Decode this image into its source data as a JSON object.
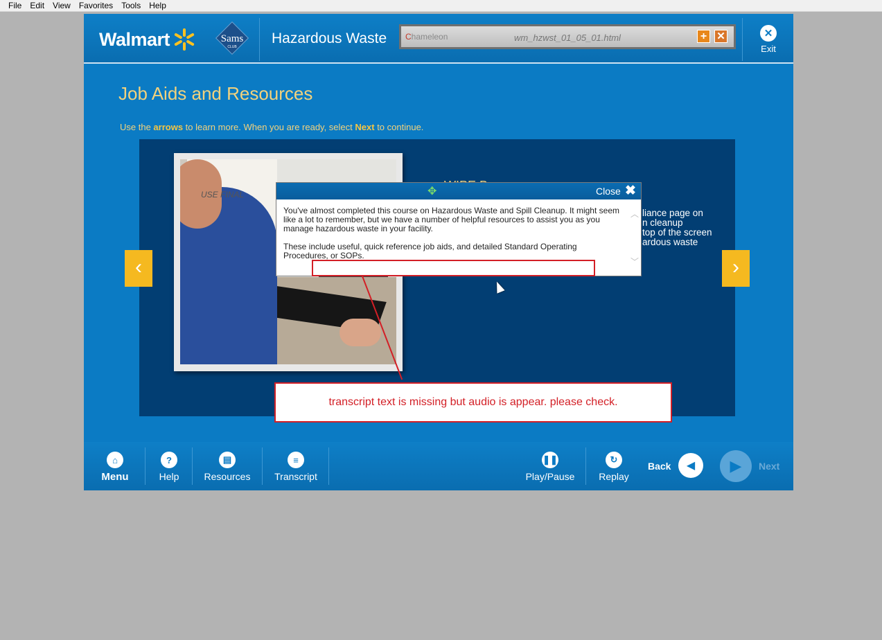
{
  "browser_menu": [
    "File",
    "Edit",
    "View",
    "Favorites",
    "Tools",
    "Help"
  ],
  "header": {
    "brand": "Walmart",
    "sams_logo": "Sams",
    "sams_sub": "CLUB",
    "course_title": "Hazardous Waste",
    "review_tool": {
      "logo_prefix": "C",
      "logo_rest": "hameleon",
      "filename": "wm_hzwst_01_05_01.html"
    },
    "exit_label": "Exit"
  },
  "content": {
    "title": "Job Aids and Resources",
    "instruction_pre": "Use the ",
    "instruction_b1": "arrows",
    "instruction_mid": " to learn more.  When you are ready, select ",
    "instruction_b2": "Next",
    "instruction_post": " to continue.",
    "photo_label": "USE FINAL",
    "partial_heading": "WIPE B",
    "partial_lines": [
      "liance page on",
      "n cleanup",
      "top of the screen",
      "ardous waste"
    ]
  },
  "popup": {
    "close_label": "Close",
    "paragraph1": "You've almost completed this course on Hazardous Waste and Spill Cleanup.  It might seem like a lot to remember, but we have a number of helpful resources to assist you as you manage hazardous waste in your facility.",
    "paragraph2": "These include useful, quick reference job aids, and detailed Standard Operating Procedures, or SOPs."
  },
  "annotation": {
    "note": "transcript text is missing but audio is appear. please check."
  },
  "footer": {
    "menu": "Menu",
    "help": "Help",
    "resources": "Resources",
    "transcript": "Transcript",
    "play_pause": "Play/Pause",
    "replay": "Replay",
    "back": "Back",
    "next": "Next"
  },
  "colors": {
    "brand_blue": "#0b7bc4",
    "accent_yellow": "#f5b920",
    "title_gold": "#f2d27d",
    "annotation_red": "#d31f26"
  }
}
